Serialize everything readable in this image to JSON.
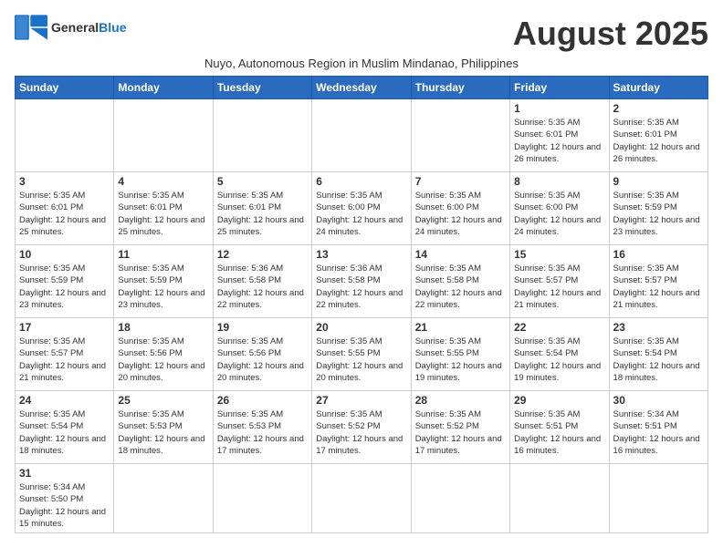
{
  "header": {
    "logo_line1": "General",
    "logo_line2": "Blue",
    "month_title": "August 2025",
    "subtitle": "Nuyo, Autonomous Region in Muslim Mindanao, Philippines"
  },
  "weekdays": [
    "Sunday",
    "Monday",
    "Tuesday",
    "Wednesday",
    "Thursday",
    "Friday",
    "Saturday"
  ],
  "weeks": [
    [
      {
        "day": "",
        "info": ""
      },
      {
        "day": "",
        "info": ""
      },
      {
        "day": "",
        "info": ""
      },
      {
        "day": "",
        "info": ""
      },
      {
        "day": "",
        "info": ""
      },
      {
        "day": "1",
        "info": "Sunrise: 5:35 AM\nSunset: 6:01 PM\nDaylight: 12 hours and 26 minutes."
      },
      {
        "day": "2",
        "info": "Sunrise: 5:35 AM\nSunset: 6:01 PM\nDaylight: 12 hours and 26 minutes."
      }
    ],
    [
      {
        "day": "3",
        "info": "Sunrise: 5:35 AM\nSunset: 6:01 PM\nDaylight: 12 hours and 25 minutes."
      },
      {
        "day": "4",
        "info": "Sunrise: 5:35 AM\nSunset: 6:01 PM\nDaylight: 12 hours and 25 minutes."
      },
      {
        "day": "5",
        "info": "Sunrise: 5:35 AM\nSunset: 6:01 PM\nDaylight: 12 hours and 25 minutes."
      },
      {
        "day": "6",
        "info": "Sunrise: 5:35 AM\nSunset: 6:00 PM\nDaylight: 12 hours and 24 minutes."
      },
      {
        "day": "7",
        "info": "Sunrise: 5:35 AM\nSunset: 6:00 PM\nDaylight: 12 hours and 24 minutes."
      },
      {
        "day": "8",
        "info": "Sunrise: 5:35 AM\nSunset: 6:00 PM\nDaylight: 12 hours and 24 minutes."
      },
      {
        "day": "9",
        "info": "Sunrise: 5:35 AM\nSunset: 5:59 PM\nDaylight: 12 hours and 23 minutes."
      }
    ],
    [
      {
        "day": "10",
        "info": "Sunrise: 5:35 AM\nSunset: 5:59 PM\nDaylight: 12 hours and 23 minutes."
      },
      {
        "day": "11",
        "info": "Sunrise: 5:35 AM\nSunset: 5:59 PM\nDaylight: 12 hours and 23 minutes."
      },
      {
        "day": "12",
        "info": "Sunrise: 5:36 AM\nSunset: 5:58 PM\nDaylight: 12 hours and 22 minutes."
      },
      {
        "day": "13",
        "info": "Sunrise: 5:36 AM\nSunset: 5:58 PM\nDaylight: 12 hours and 22 minutes."
      },
      {
        "day": "14",
        "info": "Sunrise: 5:35 AM\nSunset: 5:58 PM\nDaylight: 12 hours and 22 minutes."
      },
      {
        "day": "15",
        "info": "Sunrise: 5:35 AM\nSunset: 5:57 PM\nDaylight: 12 hours and 21 minutes."
      },
      {
        "day": "16",
        "info": "Sunrise: 5:35 AM\nSunset: 5:57 PM\nDaylight: 12 hours and 21 minutes."
      }
    ],
    [
      {
        "day": "17",
        "info": "Sunrise: 5:35 AM\nSunset: 5:57 PM\nDaylight: 12 hours and 21 minutes."
      },
      {
        "day": "18",
        "info": "Sunrise: 5:35 AM\nSunset: 5:56 PM\nDaylight: 12 hours and 20 minutes."
      },
      {
        "day": "19",
        "info": "Sunrise: 5:35 AM\nSunset: 5:56 PM\nDaylight: 12 hours and 20 minutes."
      },
      {
        "day": "20",
        "info": "Sunrise: 5:35 AM\nSunset: 5:55 PM\nDaylight: 12 hours and 20 minutes."
      },
      {
        "day": "21",
        "info": "Sunrise: 5:35 AM\nSunset: 5:55 PM\nDaylight: 12 hours and 19 minutes."
      },
      {
        "day": "22",
        "info": "Sunrise: 5:35 AM\nSunset: 5:54 PM\nDaylight: 12 hours and 19 minutes."
      },
      {
        "day": "23",
        "info": "Sunrise: 5:35 AM\nSunset: 5:54 PM\nDaylight: 12 hours and 18 minutes."
      }
    ],
    [
      {
        "day": "24",
        "info": "Sunrise: 5:35 AM\nSunset: 5:54 PM\nDaylight: 12 hours and 18 minutes."
      },
      {
        "day": "25",
        "info": "Sunrise: 5:35 AM\nSunset: 5:53 PM\nDaylight: 12 hours and 18 minutes."
      },
      {
        "day": "26",
        "info": "Sunrise: 5:35 AM\nSunset: 5:53 PM\nDaylight: 12 hours and 17 minutes."
      },
      {
        "day": "27",
        "info": "Sunrise: 5:35 AM\nSunset: 5:52 PM\nDaylight: 12 hours and 17 minutes."
      },
      {
        "day": "28",
        "info": "Sunrise: 5:35 AM\nSunset: 5:52 PM\nDaylight: 12 hours and 17 minutes."
      },
      {
        "day": "29",
        "info": "Sunrise: 5:35 AM\nSunset: 5:51 PM\nDaylight: 12 hours and 16 minutes."
      },
      {
        "day": "30",
        "info": "Sunrise: 5:34 AM\nSunset: 5:51 PM\nDaylight: 12 hours and 16 minutes."
      }
    ],
    [
      {
        "day": "31",
        "info": "Sunrise: 5:34 AM\nSunset: 5:50 PM\nDaylight: 12 hours and 15 minutes."
      },
      {
        "day": "",
        "info": ""
      },
      {
        "day": "",
        "info": ""
      },
      {
        "day": "",
        "info": ""
      },
      {
        "day": "",
        "info": ""
      },
      {
        "day": "",
        "info": ""
      },
      {
        "day": "",
        "info": ""
      }
    ]
  ]
}
